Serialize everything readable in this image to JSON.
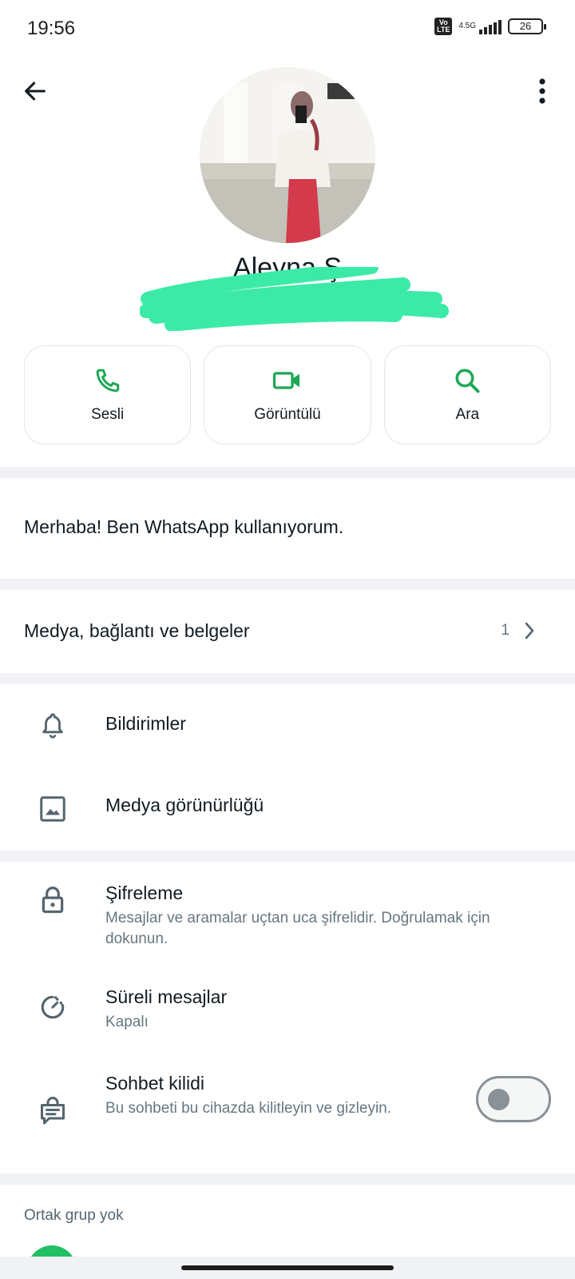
{
  "status_bar": {
    "time": "19:56",
    "volte": "Vo LTE",
    "network": "4.5G",
    "battery": "26"
  },
  "contact": {
    "name": "Aleyna Ş",
    "phone_redacted": true
  },
  "actions": [
    {
      "label": "Sesli",
      "icon": "phone-icon"
    },
    {
      "label": "Görüntülü",
      "icon": "video-icon"
    },
    {
      "label": "Ara",
      "icon": "search-icon"
    }
  ],
  "about": "Merhaba! Ben WhatsApp kullanıyorum.",
  "media": {
    "label": "Medya, bağlantı ve belgeler",
    "count": "1"
  },
  "settings": {
    "notifications": "Bildirimler",
    "media_visibility": "Medya görünürlüğü",
    "encryption_title": "Şifreleme",
    "encryption_sub": "Mesajlar ve aramalar uçtan uca şifrelidir. Doğrulamak için dokunun.",
    "disappearing_title": "Süreli mesajlar",
    "disappearing_sub": "Kapalı",
    "chat_lock_title": "Sohbet kilidi",
    "chat_lock_sub": "Bu sohbeti bu cihazda kilitleyin ve gizleyin.",
    "chat_lock_enabled": false
  },
  "groups": {
    "label": "Ortak grup yok"
  },
  "colors": {
    "accent": "#1da855",
    "text_primary": "#111b21",
    "text_secondary": "#667781",
    "scribble": "#3ceaa8"
  }
}
